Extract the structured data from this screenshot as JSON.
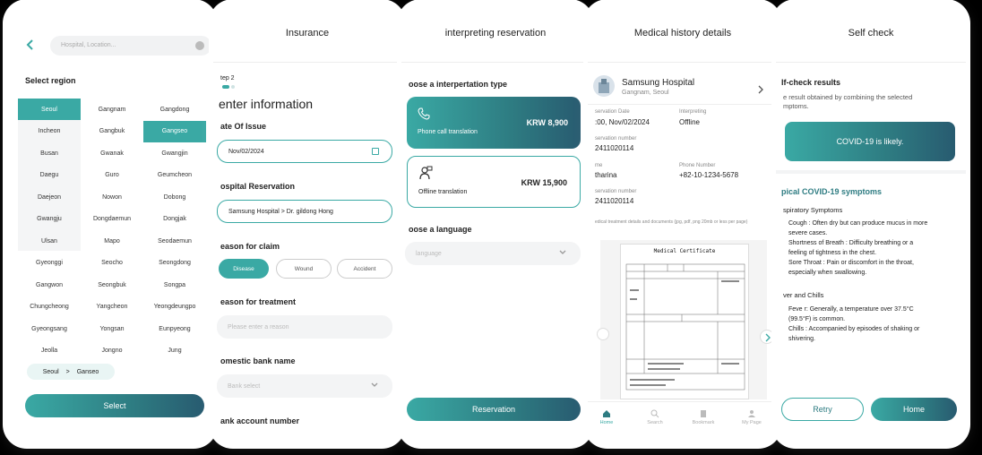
{
  "region": {
    "search_placeholder": "Hospital, Location...",
    "section_title": "Select region",
    "col1": [
      "Seoul",
      "Incheon",
      "Busan",
      "Daegu",
      "Daejeon",
      "Gwangju",
      "Ulsan",
      "Gyeonggi",
      "Gangwon",
      "Chungcheong",
      "Gyeongsang",
      "Jeolla"
    ],
    "col2": [
      "Gangnam",
      "Gangbuk",
      "Gwanak",
      "Guro",
      "Nowon",
      "Dongdaemun",
      "Mapo",
      "Seocho",
      "Seongbuk",
      "Yangcheon",
      "Yongsan",
      "Jongno"
    ],
    "col3": [
      "Gangdong",
      "Gangseo",
      "Gwangjin",
      "Geumcheon",
      "Dobong",
      "Dongjak",
      "Seodaemun",
      "Seongdong",
      "Songpa",
      "Yeongdeungpo",
      "Eunpyeong",
      "Jung"
    ],
    "chip_city": "Seoul",
    "chip_sep": ">",
    "chip_district": "Ganseo",
    "select_label": "Select"
  },
  "insurance": {
    "title": "Insurance",
    "step": "tep 2",
    "heading": "enter information",
    "date_label": "ate Of Issue",
    "date_value": "Nov/02/2024",
    "hosp_label": "ospital Reservation",
    "hosp_value": "Samsung Hospital > Dr. gildong Hong",
    "claim_label": "eason for claim",
    "claims": [
      "Disease",
      "Wound",
      "Accident"
    ],
    "treat_label": "eason for treatment",
    "treat_placeholder": "Please enter a reason",
    "bank_label": "omestic bank name",
    "bank_placeholder": "Bank select",
    "account_label": "ank account number"
  },
  "interpret": {
    "title": "interpreting reservation",
    "type_label": "oose a interpertation type",
    "phone_label": "Phone call translation",
    "phone_price": "KRW 8,900",
    "offline_label": "Offline translation",
    "offline_price": "KRW 15,900",
    "lang_label": "oose a language",
    "lang_placeholder": "language",
    "reserve_label": "Reservation"
  },
  "history": {
    "title": "Medical history details",
    "hospital": "Samsung Hospital",
    "location": "Gangnam, Seoul",
    "res_date_label": "servation Date",
    "res_date": ":00, Nov/02/2024",
    "interp_label": "Interpreting",
    "interp_value": "Offline",
    "res_no_label": "servation number",
    "res_no": "2411020114",
    "name_label": "me",
    "name_value": "tharina",
    "phone_label": "Phone Number",
    "phone_value": "+82-10-1234-5678",
    "res_no2_label": "servation number",
    "res_no2": "2411020114",
    "doc_note": "edical treatment details and documents (jpg, pdf, png 20mb or less per page)",
    "cert_title": "Medical Certificate",
    "nav": [
      "Home",
      "Search",
      "Bookmark",
      "My Page"
    ]
  },
  "selfcheck": {
    "title": "Self check",
    "results_label": "lf-check results",
    "results_desc1": "e result obtained by combining the selected",
    "results_desc2": "mptoms.",
    "verdict": "COVID-19 is likely.",
    "symptoms_title": "pical COVID-19 symptoms",
    "resp_title": "spiratory Symptoms",
    "resp": [
      "Cough : Often dry but can produce mucus in more",
      "severe cases.",
      "Shortness of Breath : Difficulty breathing or a",
      "feeling of tightness in the chest.",
      "Sore Throat : Pain or discomfort in the throat,",
      "especially when swallowing."
    ],
    "fever_title": "ver and Chills",
    "fever": [
      "Feve r: Generally, a temperature over 37.5°C",
      "(99.5°F) is common.",
      "Chills : Accompanied by episodes of shaking or",
      "shivering."
    ],
    "retry": "Retry",
    "home": "Home"
  },
  "colors": {
    "accent": "#3aa9a4",
    "accent_dark": "#285b70"
  }
}
